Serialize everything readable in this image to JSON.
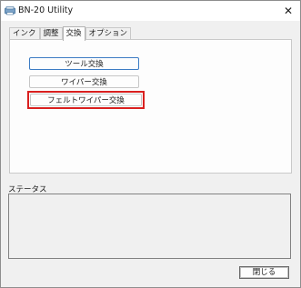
{
  "window": {
    "title": "BN-20 Utility",
    "close_glyph": "✕"
  },
  "tabs": [
    {
      "label": "インク"
    },
    {
      "label": "調整"
    },
    {
      "label": "交換",
      "active": true
    },
    {
      "label": "オプション"
    }
  ],
  "exchange": {
    "tool_label": "ツール交換",
    "wiper_label": "ワイパー交換",
    "felt_wiper_label": "フェルトワイパー交換"
  },
  "status": {
    "label": "ステータス",
    "text": ""
  },
  "footer": {
    "close_label": "閉じる"
  },
  "colors": {
    "highlight": "#d9201f",
    "focus": "#3c7cc4"
  }
}
